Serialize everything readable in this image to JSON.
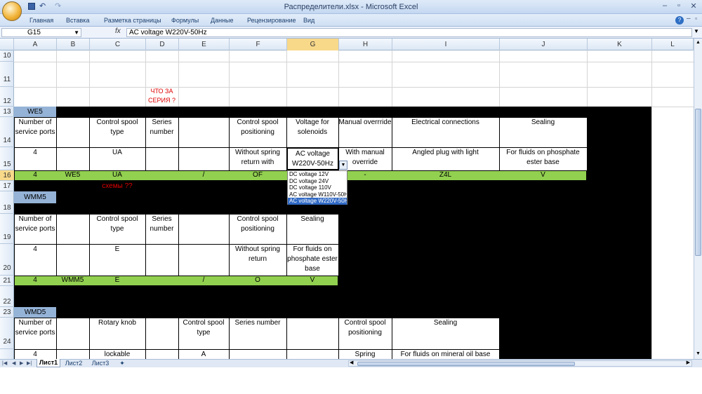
{
  "window": {
    "title": "Распределители.xlsx - Microsoft Excel"
  },
  "ribbon": {
    "tabs": [
      "Главная",
      "Вставка",
      "Разметка страницы",
      "Формулы",
      "Данные",
      "Рецензирование",
      "Вид"
    ]
  },
  "formula": {
    "cell_ref": "G15",
    "fx": "fx",
    "value": "AC voltage W220V-50Hz"
  },
  "columns": [
    "A",
    "B",
    "C",
    "D",
    "E",
    "F",
    "G",
    "H",
    "I",
    "J",
    "K",
    "L"
  ],
  "rows": [
    "10",
    "11",
    "12",
    "13",
    "14",
    "15",
    "16",
    "17",
    "18",
    "19",
    "20",
    "21",
    "22",
    "23",
    "24"
  ],
  "notes": {
    "series_q": "ЧТО ЗА СЕРИЯ ?",
    "schemes_q": "схемы ??"
  },
  "we5": {
    "tag": "WE5",
    "headers": [
      "Number of service ports",
      "Control spool type",
      "Series number",
      "Control spool positioning",
      "Voltage for solenoids",
      "Manual overrride",
      "Electrical connections",
      "Sealing"
    ],
    "values": [
      "4",
      "UA",
      "Without spring return with",
      "AC voltage W220V-50Hz",
      "With manual override",
      "Angled plug with light",
      "For fluids on phosphate ester base"
    ],
    "code": [
      "4",
      "WE5",
      "UA",
      "/",
      "OF",
      "-",
      "Z4L",
      "V"
    ]
  },
  "dropdown": {
    "options": [
      "DC voltage 12V",
      "DC voltage 24V",
      "DC voltage 110V",
      "AC voltage W110V-50H",
      "AC voltage W220V-50H"
    ],
    "selected": 4
  },
  "wmm5": {
    "tag": "WMM5",
    "headers": [
      "Number of service ports",
      "Control spool type",
      "Series number",
      "Control spool positioning",
      "Sealing"
    ],
    "values": [
      "4",
      "E",
      "Without spring return",
      "For fluids on phosphate ester base"
    ],
    "code": [
      "4",
      "WMM5",
      "E",
      "/",
      "O",
      "V"
    ]
  },
  "wmd5": {
    "tag": "WMD5",
    "headers": [
      "Number of service ports",
      "Rotary knob",
      "Control spool type",
      "Series number",
      "Control spool positioning",
      "Sealing"
    ],
    "values": [
      "4",
      "lockable",
      "A",
      "Spring",
      "For fluids on mineral oil base"
    ]
  },
  "sheets": [
    "Лист1",
    "Лист2",
    "Лист3"
  ]
}
